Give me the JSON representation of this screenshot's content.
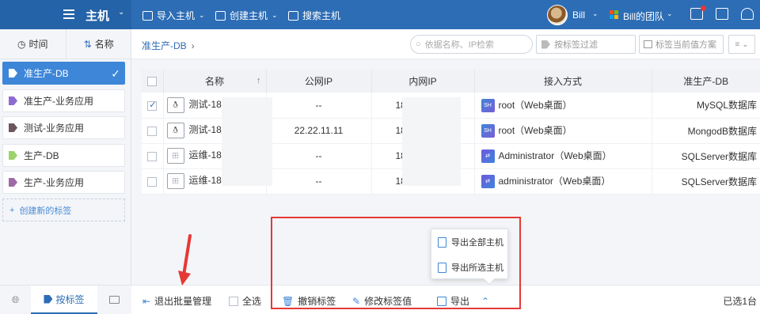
{
  "header": {
    "title": "主机",
    "menu": [
      {
        "label": "导入主机",
        "icon": "import-icon"
      },
      {
        "label": "创建主机",
        "icon": "create-icon"
      },
      {
        "label": "搜索主机",
        "icon": "search-icon"
      }
    ],
    "user": "Bill",
    "team": "Bill的团队"
  },
  "left_panel": {
    "sort_time": "时间",
    "sort_name": "名称",
    "tags": [
      {
        "label": "准生产-DB",
        "color": "#ffffff",
        "active": true
      },
      {
        "label": "准生产-业务应用",
        "color": "#8e6bd0"
      },
      {
        "label": "测试-业务应用",
        "color": "#6d5560"
      },
      {
        "label": "生产-DB",
        "color": "#9bd36a"
      },
      {
        "label": "生产-业务应用",
        "color": "#a06aa8"
      }
    ],
    "new_tag": "创建新的标签",
    "bottom_tab": "按标签"
  },
  "main": {
    "breadcrumb": "准生产-DB",
    "search_placeholder": "依据名称、IP检索",
    "tag_filter": "按标签过滤",
    "tag_scheme": "标签当前值方案"
  },
  "table": {
    "columns": [
      "名称",
      "公网IP",
      "内网IP",
      "接入方式",
      "准生产-DB"
    ],
    "rows": [
      {
        "checked": true,
        "os": "linux",
        "name": "测试-18",
        "public_ip": "--",
        "private_ip": "18",
        "access": "root（Web桌面）",
        "value": "MySQL数据库"
      },
      {
        "checked": false,
        "os": "linux",
        "name": "测试-18",
        "public_ip": "22.22.11.11",
        "private_ip": "18",
        "access": "root（Web桌面）",
        "value": "MongodB数据库"
      },
      {
        "checked": false,
        "os": "windows",
        "name": "运维-18",
        "public_ip": "--",
        "private_ip": "18",
        "access": "Administrator（Web桌面）",
        "value": "SQLServer数据库"
      },
      {
        "checked": false,
        "os": "windows",
        "name": "运维-18",
        "public_ip": "--",
        "private_ip": "18",
        "access": "administrator（Web桌面）",
        "value": "SQLServer数据库"
      }
    ]
  },
  "popup": {
    "export_all": "导出全部主机",
    "export_selected": "导出所选主机"
  },
  "bottombar": {
    "exit_batch": "退出批量管理",
    "select_all": "全选",
    "revoke_tag": "撤销标签",
    "modify_tag": "修改标签值",
    "export": "导出",
    "selected_count": "已选1台"
  }
}
